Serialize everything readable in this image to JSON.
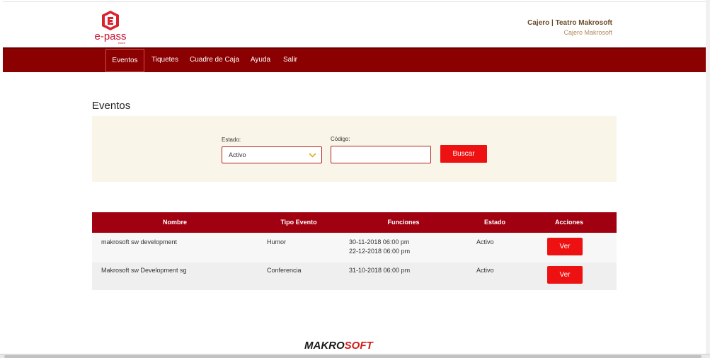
{
  "header": {
    "logo_text_e": "e",
    "logo_text_pass": "pass",
    "logo_sub": "event",
    "user_name": "Cajero | Teatro Makrosoft",
    "user_role": "Cajero Makrosoft"
  },
  "nav": {
    "items": [
      {
        "label": "Eventos",
        "active": true
      },
      {
        "label": "Tiquetes"
      },
      {
        "label": "Cuadre de Caja"
      },
      {
        "label": "Ayuda"
      },
      {
        "label": "Salir"
      }
    ]
  },
  "page": {
    "title": "Eventos"
  },
  "filters": {
    "estado_label": "Estado:",
    "estado_value": "Activo",
    "codigo_label": "Código:",
    "codigo_value": "",
    "buscar_label": "Buscar"
  },
  "table": {
    "headers": [
      "Nombre",
      "Tipo Evento",
      "Funciones",
      "Estado",
      "Acciones"
    ],
    "rows": [
      {
        "nombre": "makrosoft sw development",
        "tipo": "Humor",
        "funciones": [
          "30-11-2018 06:00 pm",
          "22-12-2018 06:00 pm"
        ],
        "estado": "Activo",
        "accion": "Ver"
      },
      {
        "nombre": "Makrosoft sw Development sg",
        "tipo": "Conferencia",
        "funciones": [
          "31-10-2018 06:00 pm"
        ],
        "estado": "Activo",
        "accion": "Ver"
      }
    ]
  },
  "footer": {
    "brand_part1": "MAKRO",
    "brand_part2": "SOFT"
  },
  "colors": {
    "nav_bg": "#8b0000",
    "table_header_bg": "#a00010",
    "button_red": "#ee1111",
    "filter_bg": "#f9f5e8"
  }
}
